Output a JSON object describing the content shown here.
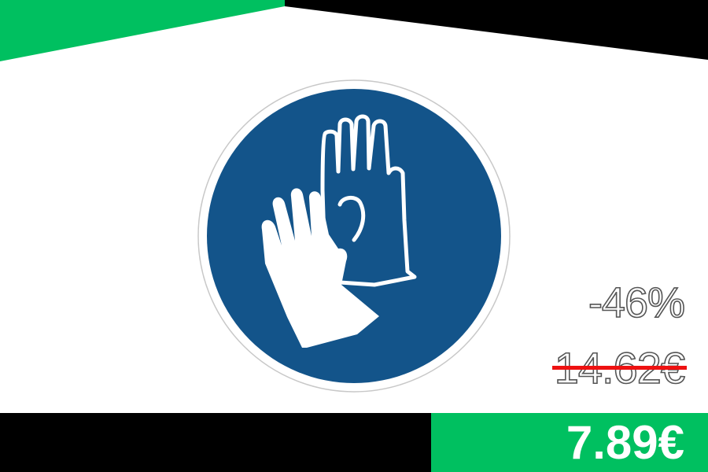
{
  "colors": {
    "accent_green": "#00c060",
    "black": "#000000",
    "sign_blue": "#13548a",
    "strike_red": "#ee1111"
  },
  "sign": {
    "icon": "protective-gloves-icon"
  },
  "pricing": {
    "discount": "-46%",
    "old_price": "14.62€",
    "new_price": "7.89€"
  }
}
